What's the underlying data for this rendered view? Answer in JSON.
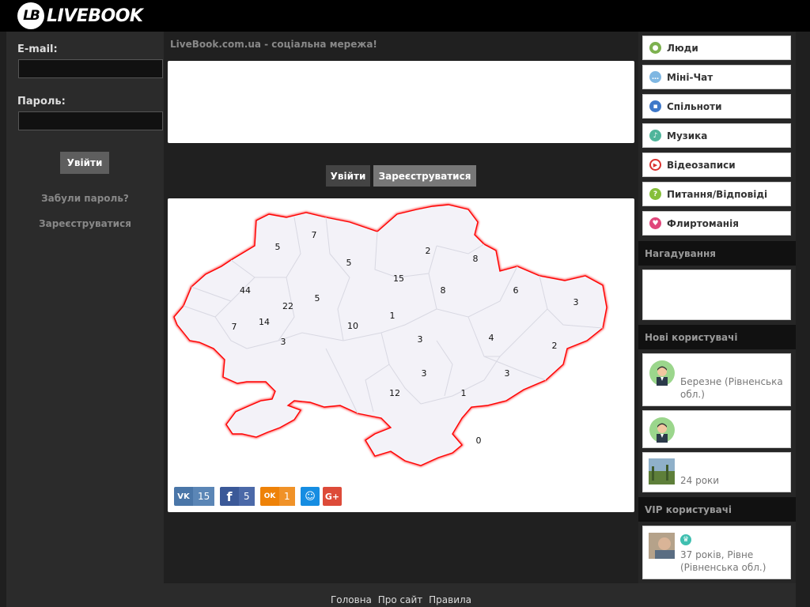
{
  "header": {
    "logo_badge": "LB",
    "logo_text": "LIVEBOOK"
  },
  "login": {
    "email_label": "E-mail:",
    "email_value": "",
    "password_label": "Пароль:",
    "password_value": "",
    "login_button": "Увійти",
    "forgot_link": "Забули пароль?",
    "register_link": "Зареєструватися"
  },
  "main": {
    "title": "LiveBook.com.ua - соціальна мережа!",
    "login_button": "Увійти",
    "register_button": "Зареєструватися",
    "map_numbers": [
      "5",
      "7",
      "5",
      "2",
      "8",
      "15",
      "44",
      "22",
      "5",
      "8",
      "6",
      "3",
      "7",
      "14",
      "10",
      "1",
      "3",
      "4",
      "2",
      "3",
      "3",
      "3",
      "12",
      "1",
      "0"
    ],
    "share": [
      {
        "icon": "vk-icon",
        "label": "VK",
        "count": "15",
        "color": "#4a76a8"
      },
      {
        "icon": "facebook-icon",
        "label": "f",
        "count": "5",
        "color": "#3b5998"
      },
      {
        "icon": "odnoklassniki-icon",
        "label": "OK",
        "count": "1",
        "color": "#ee8208"
      },
      {
        "icon": "moimir-icon",
        "label": "☺",
        "count": "",
        "color": "#168de2"
      },
      {
        "icon": "googleplus-icon",
        "label": "G+",
        "count": "",
        "color": "#dd4b39"
      }
    ]
  },
  "sidebar": {
    "menu": [
      {
        "label": "Люди",
        "icon": "people-icon",
        "color": "#7db14f"
      },
      {
        "label": "Міні-Чат",
        "icon": "chat-icon",
        "color": "#7fb7e2"
      },
      {
        "label": "Спільноти",
        "icon": "communities-icon",
        "color": "#3e78c9"
      },
      {
        "label": "Музика",
        "icon": "music-icon",
        "color": "#4fb59b"
      },
      {
        "label": "Відеозаписи",
        "icon": "video-icon",
        "color": "#d9322f"
      },
      {
        "label": "Питання/Відповіді",
        "icon": "question-icon",
        "color": "#86bf3b"
      },
      {
        "label": "Флиртоманія",
        "icon": "heart-icon",
        "color": "#e0467a"
      }
    ],
    "reminders_title": "Нагадування",
    "new_users_title": "Нові користувачі",
    "new_users": [
      {
        "text": "Березне (Рівненська обл.)"
      },
      {
        "text": ""
      },
      {
        "text": "24 роки"
      }
    ],
    "vip_title": "VIP користувачі",
    "vip_users": [
      {
        "text": "37 років, Рівне (Рівненська обл.)"
      }
    ]
  },
  "footer": {
    "links": [
      "Головна",
      "Про сайт",
      "Правила"
    ]
  }
}
